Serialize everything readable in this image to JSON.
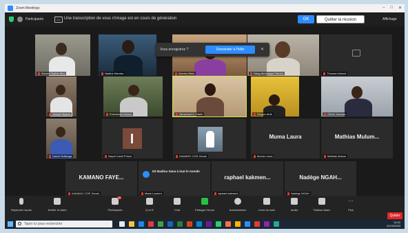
{
  "window": {
    "title": "Zoom Meetings",
    "controls": [
      "–",
      "□",
      "✕"
    ]
  },
  "header": {
    "participants_label": "Participants",
    "caption_text": "Une transcription de vous n'image est en cours de génération",
    "ok_label": "OK",
    "quit_label": "Quitter la réunion",
    "view_label": "Affichage"
  },
  "recording_prompt": {
    "question": "Vous enregistrez ?",
    "ask_label": "Demander à l'hôte",
    "close": "✕"
  },
  "tiles": [
    {
      "name": "Ahmed Ouédr. Ibra",
      "type": "video"
    },
    {
      "name": "Nadine Maraba",
      "type": "video"
    },
    {
      "name": "Mamba Bello",
      "type": "video"
    },
    {
      "name": "Ndag Abdoulaye Patrick",
      "type": "video"
    },
    {
      "name": "Thomas Kaboré",
      "type": "video"
    },
    {
      "name": "Joseph Mgene",
      "type": "video"
    },
    {
      "name": "Emmanuel Kerem",
      "type": "video"
    },
    {
      "name": "Alinamawi A. Diallo",
      "type": "video"
    },
    {
      "name": "Serges Aïdé",
      "type": "video"
    },
    {
      "name": "Olivier Kamara",
      "type": "video"
    },
    {
      "name": "Daniel Ndilanga",
      "type": "video"
    },
    {
      "name": "Nepal Camil Prince",
      "type": "video"
    },
    {
      "name": "KAMARO COR Zenab",
      "type": "video"
    },
    {
      "name": "Muma Laura",
      "display": "Muma Laura",
      "type": "name"
    },
    {
      "name": "Mathias Mulum",
      "display": "Mathias Mulum...",
      "type": "name"
    },
    {
      "name": "KAMANO COR Zenab",
      "display": "KAMANO FAYE...",
      "type": "name"
    },
    {
      "name": "Marie Laurent",
      "display": "Dé Badiou Sana à tout le monde",
      "type": "name"
    },
    {
      "name": "raphael kakmeni",
      "display": "raphael kakmen...",
      "type": "name"
    },
    {
      "name": "Nadège NGAH",
      "display": "Nadège NGAH...",
      "type": "name"
    }
  ],
  "toolbar": {
    "items": [
      {
        "label": "Rejoindre l'audio",
        "icon": "mic-icon"
      },
      {
        "label": "Arrêter la vidéo",
        "icon": "video-icon"
      },
      {
        "label": "Participants",
        "icon": "participants-icon",
        "badge": "19"
      },
      {
        "label": "Q et R",
        "icon": "qa-icon"
      },
      {
        "label": "Chat",
        "icon": "chat-icon"
      },
      {
        "label": "Partager l'écran",
        "icon": "share-screen-icon"
      },
      {
        "label": "Autoréactions",
        "icon": "reactions-icon"
      },
      {
        "label": "Lever la main",
        "icon": "raise-hand-icon"
      },
      {
        "label": "Audio",
        "icon": "audio-icon"
      },
      {
        "label": "Tableau blanc",
        "icon": "whiteboard-icon"
      },
      {
        "label": "Plus",
        "icon": "more-icon"
      }
    ],
    "end_label": "Quitter"
  },
  "taskbar": {
    "search_placeholder": "Taper ici pour rechercher",
    "time": "14:02",
    "date": "21/10/2023"
  },
  "colors": {
    "accent": "#2d8cff",
    "end": "#e02828",
    "active_speaker": "#d4e64b"
  }
}
